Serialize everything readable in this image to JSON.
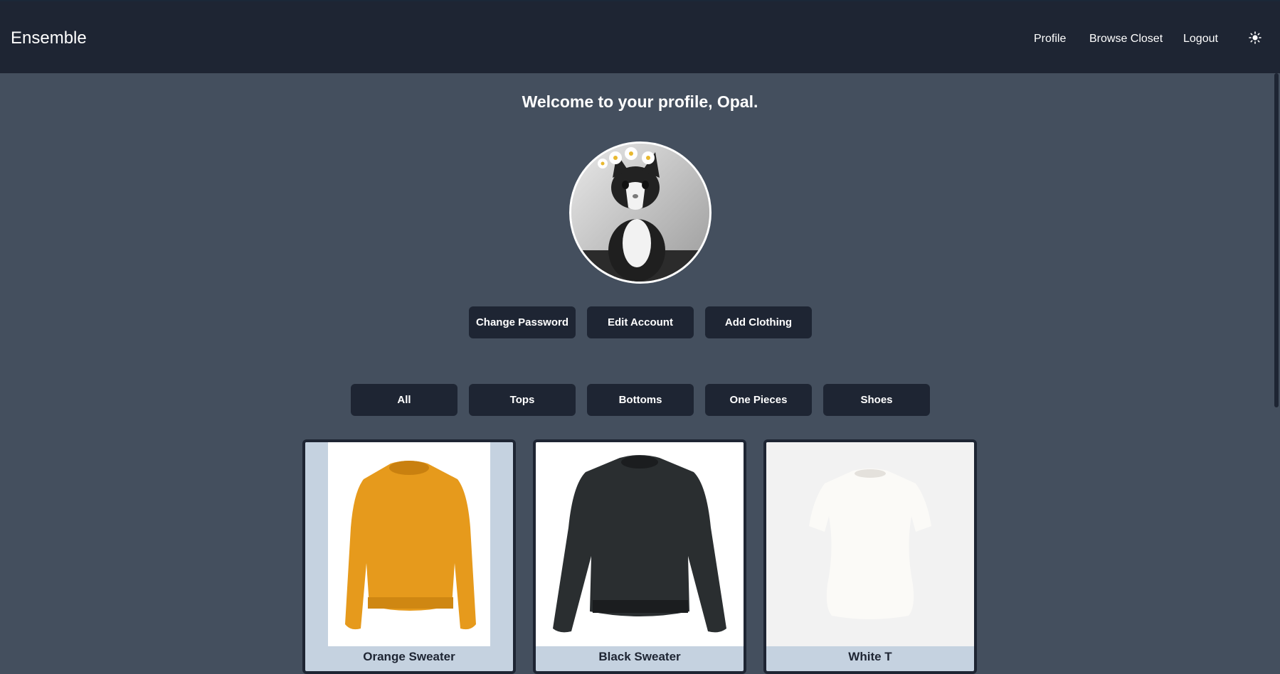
{
  "navbar": {
    "brand": "Ensemble",
    "links": [
      "Profile",
      "Browse Closet",
      "Logout"
    ],
    "theme_icon": "sun-icon"
  },
  "profile": {
    "welcome": "Welcome to your profile, Opal.",
    "avatar_icon": "cat-avatar"
  },
  "account_actions": [
    "Change Password",
    "Edit Account",
    "Add Clothing"
  ],
  "filters": [
    "All",
    "Tops",
    "Bottoms",
    "One Pieces",
    "Shoes"
  ],
  "closet": {
    "items": [
      {
        "name": "Orange Sweater",
        "color": "#e69a1c"
      },
      {
        "name": "Black Sweater",
        "color": "#2a2e30"
      },
      {
        "name": "White T",
        "color": "#f4f2ee"
      }
    ]
  },
  "colors": {
    "page_bg": "#444f5e",
    "nav_bg": "#1e2533",
    "button_bg": "#1e2533",
    "card_bg": "#c5d2e0"
  }
}
